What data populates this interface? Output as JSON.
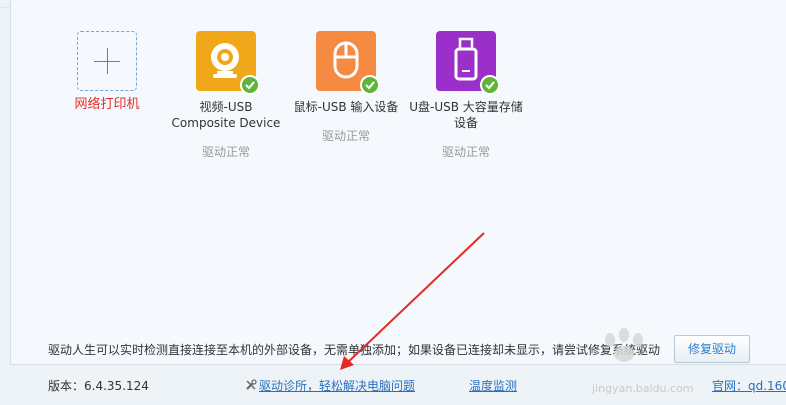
{
  "devices": [
    {
      "name": "网络打印机",
      "status": "",
      "icon": "plus-icon"
    },
    {
      "name": "视频-USB Composite Device",
      "status": "驱动正常",
      "icon": "webcam-icon"
    },
    {
      "name": "鼠标-USB 输入设备",
      "status": "驱动正常",
      "icon": "mouse-icon"
    },
    {
      "name": "U盘-USB 大容量存储设备",
      "status": "驱动正常",
      "icon": "usb-drive-icon"
    }
  ],
  "info_text": "驱动人生可以实时检测直接连接至本机的外部设备，无需单独添加；如果设备已连接却未显示，请尝试修复系统驱动",
  "repair_button": "修复驱动",
  "footer": {
    "version": "版本：6.4.35.124",
    "diagnose_link": "驱动诊所，轻松解决电脑问题",
    "temperature_link": "温度监测",
    "site_link": "官网：qd.160"
  },
  "watermark": "jingyan.baidu.com",
  "colors": {
    "accent": "#2a6fbf",
    "printer_label": "#e0302a",
    "check": "#5fb53a",
    "arrow": "#e32b23"
  }
}
